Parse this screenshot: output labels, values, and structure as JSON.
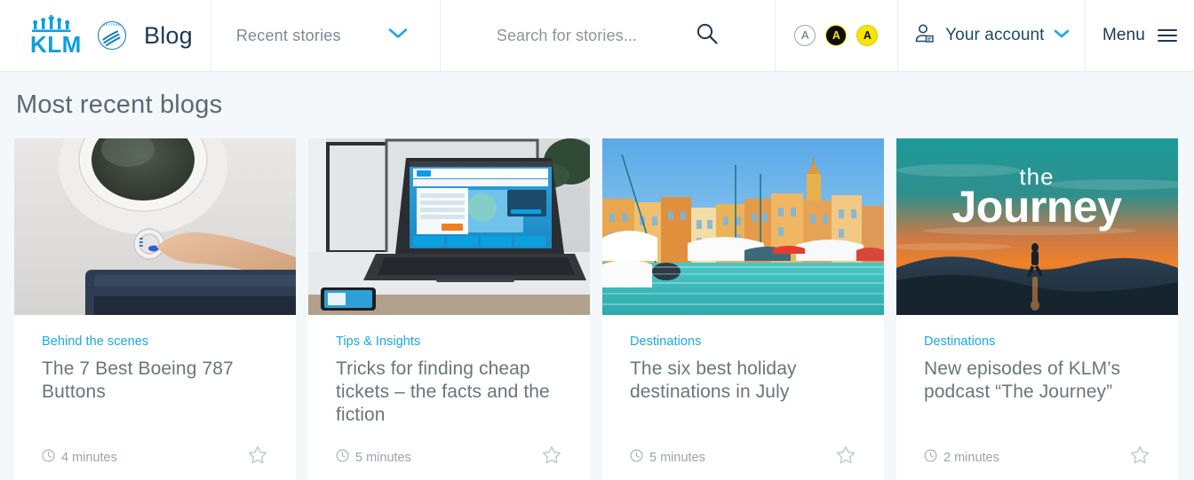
{
  "header": {
    "brand": {
      "logo_icon": "klm-crown-logo",
      "skyteam_icon": "skyteam-logo",
      "blog_label": "Blog"
    },
    "recent_stories": {
      "label": "Recent stories",
      "chevron_icon": "chevron-down-icon"
    },
    "search": {
      "placeholder": "Search for stories...",
      "value": "",
      "icon": "search-icon"
    },
    "accessibility": {
      "buttons": [
        {
          "label": "A",
          "style": "plain",
          "title": "normal-contrast"
        },
        {
          "label": "A",
          "style": "invert",
          "title": "high-contrast"
        },
        {
          "label": "A",
          "style": "yellow",
          "title": "yellow-contrast"
        }
      ],
      "colors": {
        "yellow": "#f5e500",
        "black": "#0d0d0d",
        "outline": "#9aa4ab"
      }
    },
    "account": {
      "label": "Your account",
      "icon": "user-account-icon",
      "chevron_icon": "chevron-down-icon"
    },
    "menu": {
      "label": "Menu",
      "icon": "hamburger-menu-icon"
    }
  },
  "page": {
    "title": "Most recent blogs",
    "background_color": "#f4f8fb",
    "accent_color": "#1aa7e8"
  },
  "cards": [
    {
      "category": "Behind the scenes",
      "title": "The 7 Best Boeing 787 Buttons",
      "read_time": "4 minutes",
      "clock_icon": "clock-icon",
      "star_icon": "star-outline-icon",
      "image_alt": "aircraft-window-dimmer-button"
    },
    {
      "category": "Tips & Insights",
      "title": "Tricks for finding cheap tickets – the facts and the fiction",
      "read_time": "5 minutes",
      "clock_icon": "clock-icon",
      "star_icon": "star-outline-icon",
      "image_alt": "laptop-with-klm-booking-site"
    },
    {
      "category": "Destinations",
      "title": "The six best holiday destinations in July",
      "read_time": "5 minutes",
      "clock_icon": "clock-icon",
      "star_icon": "star-outline-icon",
      "image_alt": "mediterranean-harbour-with-boats"
    },
    {
      "category": "Destinations",
      "title": "New episodes of KLM’s podcast “The Journey”",
      "read_time": "2 minutes",
      "clock_icon": "clock-icon",
      "star_icon": "star-outline-icon",
      "image_alt": "the-journey-podcast-sunset-artwork"
    }
  ]
}
